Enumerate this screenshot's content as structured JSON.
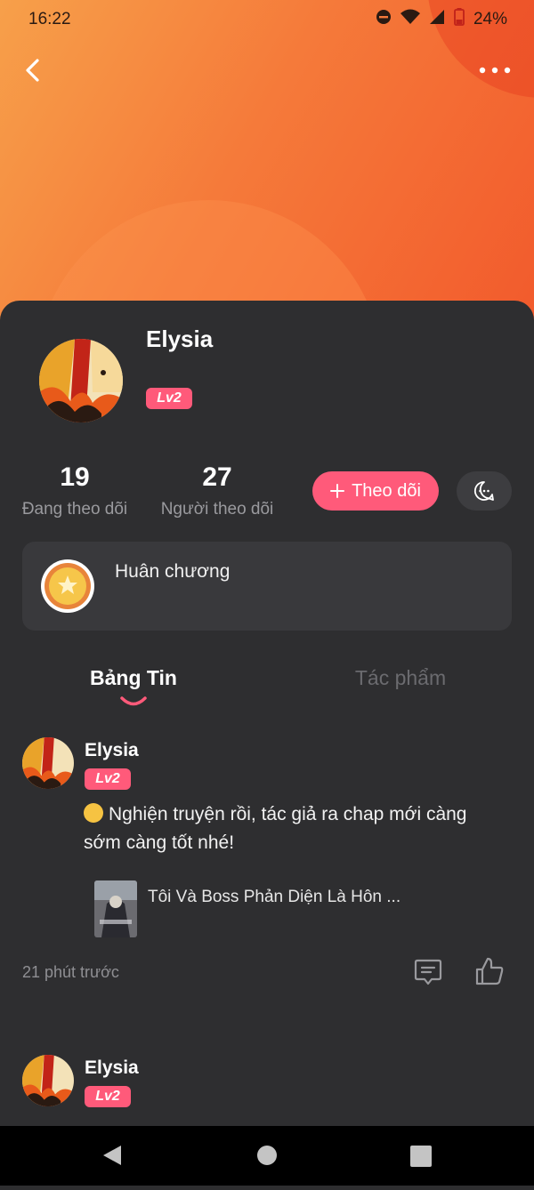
{
  "status_bar": {
    "time": "16:22",
    "battery": "24%",
    "icons": [
      "dnd-icon",
      "wifi-icon",
      "signal-icon",
      "battery-icon"
    ]
  },
  "colors": {
    "accent": "#ff5a7a",
    "hero_start": "#f7a04a",
    "hero_end": "#f25a2c",
    "background": "#2d2d2f"
  },
  "profile": {
    "name": "Elysia",
    "level": "Lv2",
    "following_count": "19",
    "following_label": "Đang theo dõi",
    "followers_count": "27",
    "followers_label": "Người theo dõi",
    "follow_button": "Theo dõi",
    "medal_label": "Huân chương"
  },
  "tabs": [
    {
      "label": "Bảng Tin",
      "active": true
    },
    {
      "label": "Tác phẩm",
      "active": false
    }
  ],
  "posts": [
    {
      "author": "Elysia",
      "level": "Lv2",
      "text": "Nghiện truyện rồi, tác giả ra chap mới càng sớm càng tốt nhé!",
      "book_title": "Tôi Và Boss Phản Diện Là Hôn ...",
      "time": "21 phút trước"
    },
    {
      "author": "Elysia",
      "level": "Lv2"
    }
  ]
}
